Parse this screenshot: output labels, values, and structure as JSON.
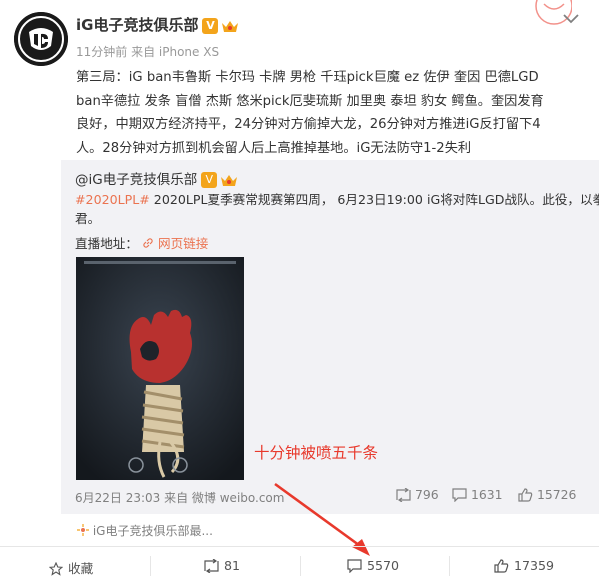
{
  "post": {
    "username": "iG电子竞技俱乐部",
    "verified_badge": "V",
    "meta": "11分钟前 来自 iPhone XS",
    "text_lines": [
      "第三局：iG ban韦鲁斯 卡尔玛 卡牌 男枪 千珏pick巨魔 ez 佐伊 奎因 巴德LGD",
      "ban辛德拉 发条 盲僧 杰斯 悠米pick厄斐琉斯 加里奥 泰坦 豹女 鳄鱼。奎因发育",
      "良好，中期双方经济持平，24分钟对方偷掉大龙，26分钟对方推进iG反打留下4",
      "人。28分钟对方抓到机会留人后上高推掉基地。iG无法防守1-2失利"
    ]
  },
  "repost": {
    "username": "@iG电子竞技俱乐部",
    "hashtag": "#2020LPL#",
    "text_line1_rest": " 2020LPL夏季赛常规赛第四周， 6月23日19:00 iG将对阵LGD战队。此役，以拳会",
    "text_line2": "君。",
    "live_label": "直播地址：",
    "live_link": "网页链接",
    "time_source": "6月22日 23:03 来自 微博 weibo.com",
    "reposts": "796",
    "comments": "1631",
    "likes": "15726"
  },
  "annotation": "十分钟被喷五千条",
  "liked_by": "iG电子竞技俱乐部最...",
  "actions": {
    "collect": "收藏",
    "repost": "81",
    "comment": "5570",
    "like": "17359"
  },
  "colors": {
    "accent_orange": "#eb7350",
    "annotation_red": "#e8392c",
    "repost_bg": "#f2f2f5"
  }
}
